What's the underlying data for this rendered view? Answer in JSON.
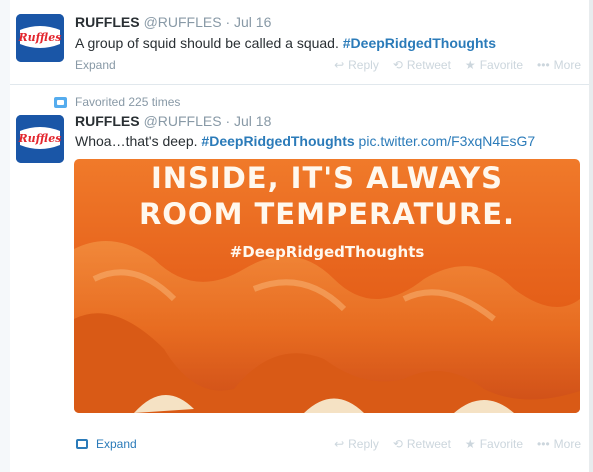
{
  "tweet1": {
    "name": "RUFFLES",
    "handle": "@RUFFLES",
    "separator": "·",
    "date": "Jul 16",
    "text": "A group of squid should be called a squad.",
    "hashtag": "#DeepRidgedThoughts",
    "expand": "Expand",
    "actions": {
      "reply": "Reply",
      "retweet": "Retweet",
      "favorite": "Favorite",
      "more": "More"
    }
  },
  "tweet2": {
    "favorited": "Favorited 225 times",
    "name": "RUFFLES",
    "handle": "@RUFFLES",
    "separator": "·",
    "date": "Jul 18",
    "text": "Whoa…that's deep.",
    "hashtag": "#DeepRidgedThoughts",
    "link": "pic.twitter.com/F3xqN4EsG7",
    "media": {
      "line1": "INSIDE, IT'S ALWAYS",
      "line2": "ROOM TEMPERATURE.",
      "tag": "#DeepRidgedThoughts"
    },
    "expand": "Expand",
    "actions": {
      "reply": "Reply",
      "retweet": "Retweet",
      "favorite": "Favorite",
      "more": "More"
    }
  },
  "avatar": {
    "logo_text": "Ruffles",
    "brand_color": "#1a56a7",
    "logo_color": "#e3262e"
  },
  "colors": {
    "link": "#2b7bb9",
    "muted": "#8899a6",
    "action": "#ccd6dd"
  },
  "icons": [
    "reply-icon",
    "retweet-icon",
    "favorite-star-icon",
    "more-dots-icon",
    "favorited-icon",
    "expand-media-icon"
  ]
}
